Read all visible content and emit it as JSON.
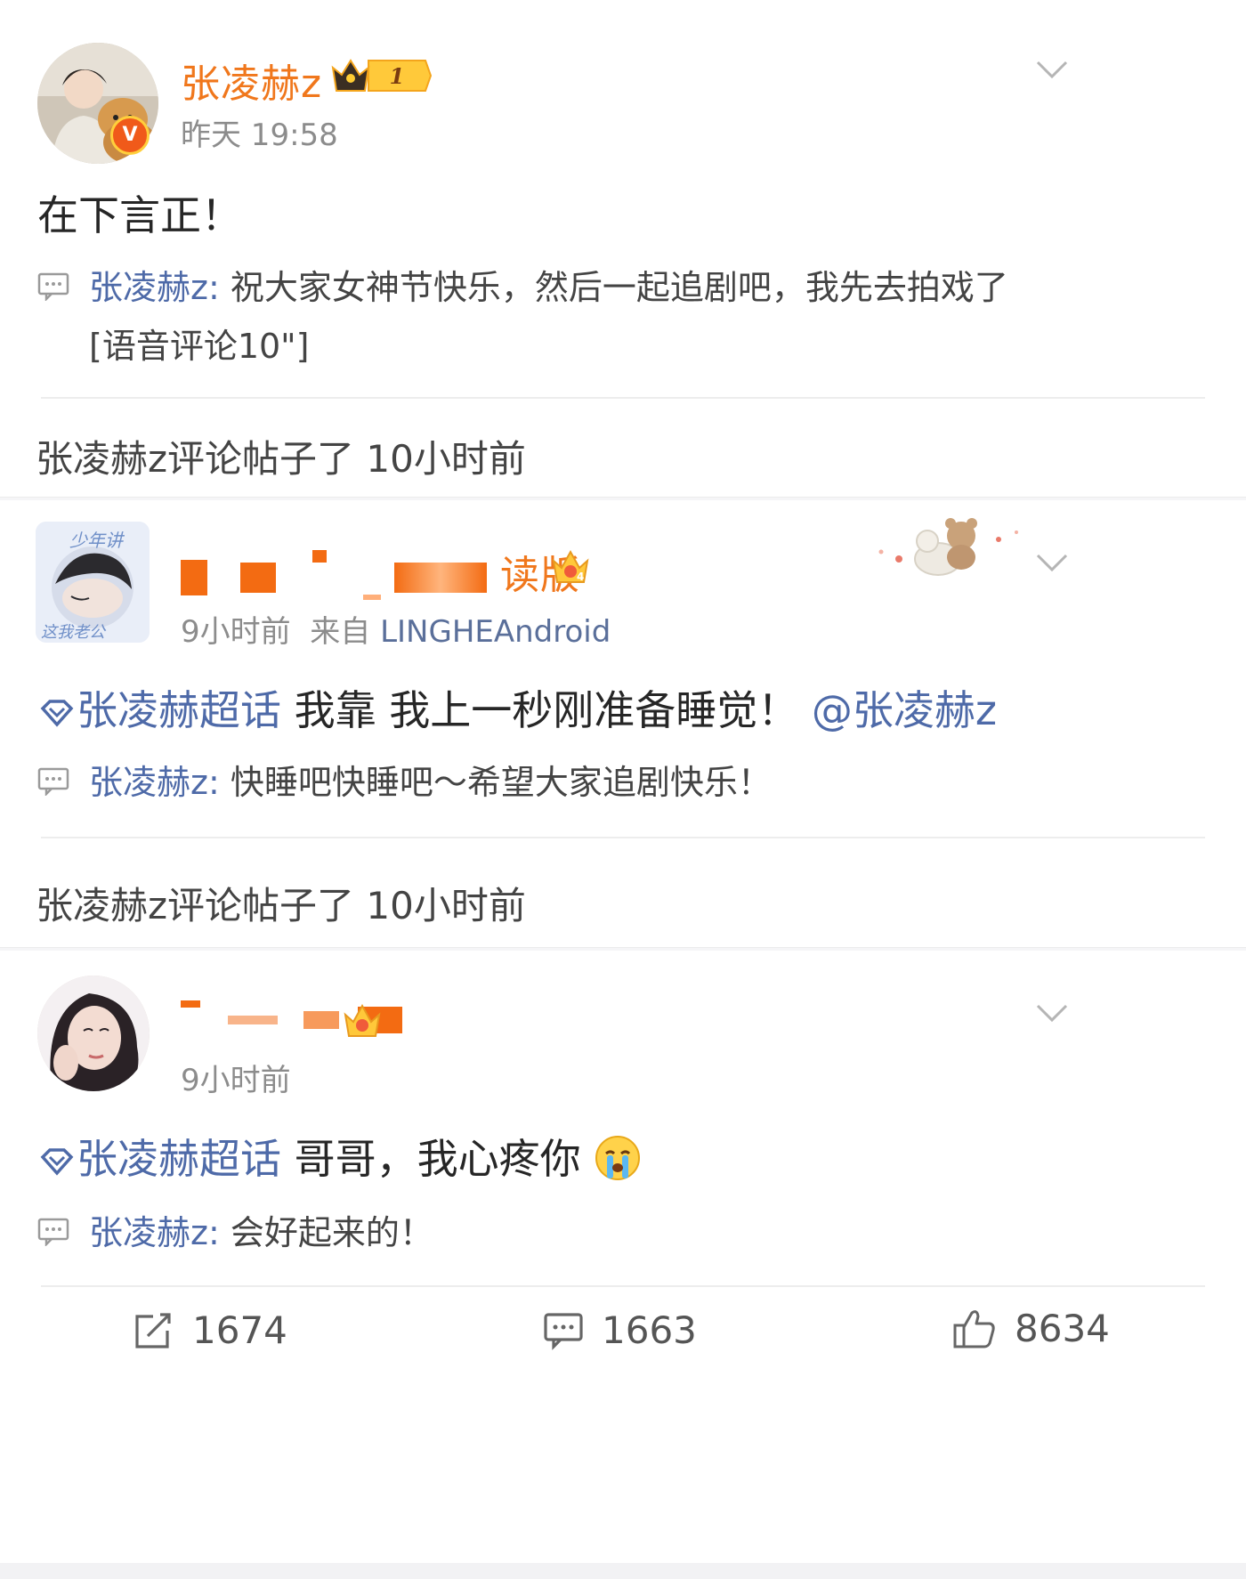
{
  "post1": {
    "username": "张凌赫z",
    "level": "1",
    "timestamp": "昨天 19:58",
    "text": "在下言正！",
    "reply_name": "张凌赫z:",
    "reply_text": " 祝大家女神节快乐，然后一起追剧吧，我先去拍戏了",
    "reply_text2": "[语音评论10\"]",
    "icons": {
      "avatar": "avatar-man-with-dog",
      "badge": "verified-v",
      "crown": "vip-crown-icon"
    }
  },
  "activity1": {
    "text": "张凌赫z评论帖子了 10小时前"
  },
  "post2": {
    "username_visible": "读版",
    "timestamp": "9小时前",
    "source_prefix": "来自",
    "source": "LINGHEAndroid",
    "topic": "张凌赫超话",
    "text": " 我靠 我上一秒刚准备睡觉！ ",
    "mention": "@张凌赫z",
    "reply_name": "张凌赫z:",
    "reply_text": " 快睡吧快睡吧～希望大家追剧快乐！",
    "avatar_text_top": "少年讲",
    "avatar_text_bottom": "这我老公"
  },
  "activity2": {
    "text": "张凌赫z评论帖子了 10小时前"
  },
  "post3": {
    "timestamp": "9小时前",
    "topic": "张凌赫超话",
    "text": " 哥哥，我心疼你",
    "emoji": "crying-face-emoji",
    "reply_name": "张凌赫z:",
    "reply_text": " 会好起来的！"
  },
  "footer": {
    "repost_count": "1674",
    "comment_count": "1663",
    "like_count": "8634"
  },
  "colors": {
    "username": "#f0771c",
    "link": "#4e6aa8",
    "meta": "#8c8c8c",
    "text": "#262626"
  }
}
